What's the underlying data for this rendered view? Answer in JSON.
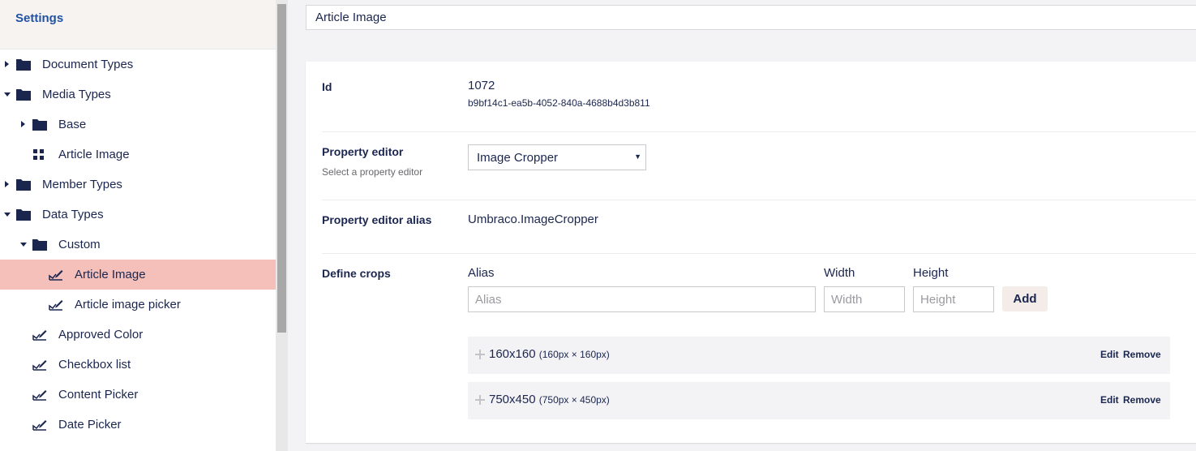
{
  "tree": {
    "title": "Settings",
    "items": [
      {
        "label": "Document Types",
        "icon": "folder-icon"
      },
      {
        "label": "Media Types",
        "icon": "folder-icon"
      },
      {
        "label": "Base",
        "icon": "folder-icon"
      },
      {
        "label": "Article Image",
        "icon": "grid-icon"
      },
      {
        "label": "Member Types",
        "icon": "folder-icon"
      },
      {
        "label": "Data Types",
        "icon": "folder-icon"
      },
      {
        "label": "Custom",
        "icon": "folder-icon"
      },
      {
        "label": "Article Image",
        "icon": "datatype-icon"
      },
      {
        "label": "Article image picker",
        "icon": "datatype-icon"
      },
      {
        "label": "Approved Color",
        "icon": "datatype-icon"
      },
      {
        "label": "Checkbox list",
        "icon": "datatype-icon"
      },
      {
        "label": "Content Picker",
        "icon": "datatype-icon"
      },
      {
        "label": "Date Picker",
        "icon": "datatype-icon"
      }
    ],
    "selected_color": "#f4c0b9"
  },
  "editor": {
    "name": "Article Image",
    "id_label": "Id",
    "id_value": "1072",
    "guid": "b9bf14c1-ea5b-4052-840a-4688b4d3b811",
    "property_editor_label": "Property editor",
    "property_editor_hint": "Select a property editor",
    "property_editor_value": "Image Cropper",
    "alias_label": "Property editor alias",
    "alias_value": "Umbraco.ImageCropper",
    "crops_label": "Define crops",
    "col_alias": "Alias",
    "col_width": "Width",
    "col_height": "Height",
    "ph_alias": "Alias",
    "ph_width": "Width",
    "ph_height": "Height",
    "add_label": "Add",
    "crops": [
      {
        "name": "160x160",
        "dims": "(160px × 160px)",
        "edit": "Edit",
        "remove": "Remove"
      },
      {
        "name": "750x450",
        "dims": "(750px × 450px)",
        "edit": "Edit",
        "remove": "Remove"
      }
    ]
  },
  "colors": {
    "navy": "#1b264f",
    "accent_blue": "#2152a3"
  }
}
